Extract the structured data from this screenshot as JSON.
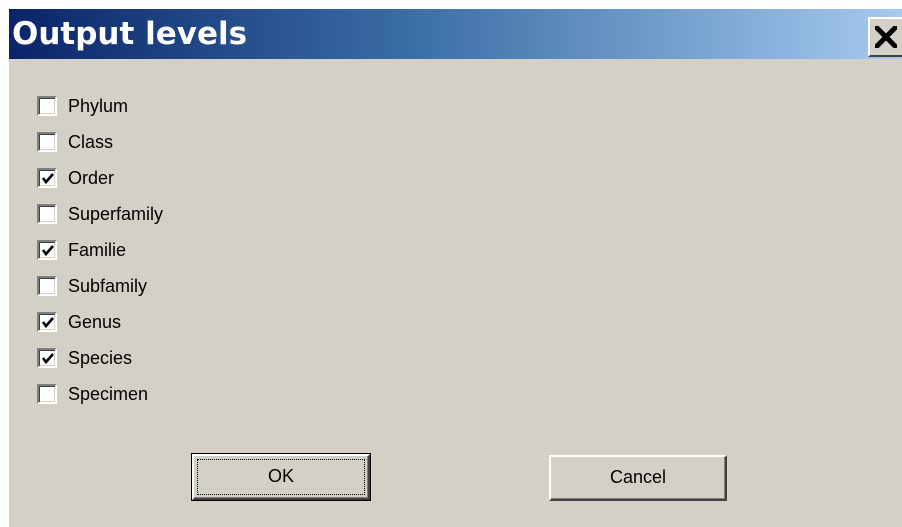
{
  "window": {
    "title": "Output levels",
    "close_glyph": "✕",
    "close_icon": "close-icon"
  },
  "levels": [
    {
      "label": "Phylum",
      "checked": false
    },
    {
      "label": "Class",
      "checked": false
    },
    {
      "label": "Order",
      "checked": true
    },
    {
      "label": "Superfamily",
      "checked": false
    },
    {
      "label": "Familie",
      "checked": true
    },
    {
      "label": "Subfamily",
      "checked": false
    },
    {
      "label": "Genus",
      "checked": true
    },
    {
      "label": "Species",
      "checked": true
    },
    {
      "label": "Specimen",
      "checked": false
    }
  ],
  "buttons": {
    "ok_label": "OK",
    "cancel_label": "Cancel"
  },
  "colors": {
    "title_gradient_start": "#0a246a",
    "title_gradient_end": "#a6caf0",
    "dialog_face": "#d4d0c8"
  }
}
